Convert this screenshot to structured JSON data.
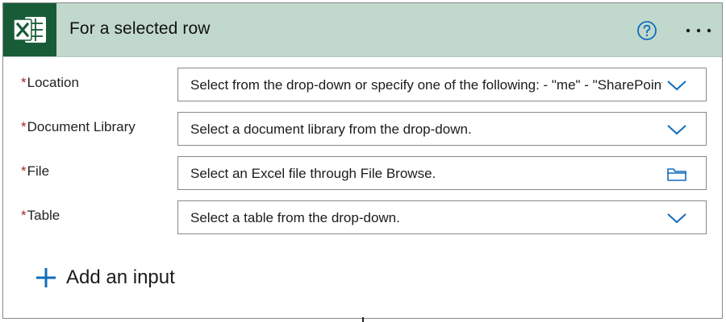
{
  "header": {
    "app_icon": "excel-icon",
    "title": "For a selected row",
    "help_icon": "help-circle-icon",
    "more_icon": "ellipsis-icon"
  },
  "fields": [
    {
      "label": "Location",
      "required_mark": "*",
      "value": "Select from the drop-down or specify one of the following: - \"me\" - \"SharePoint Site URL\"",
      "icon": "chevron-down-icon"
    },
    {
      "label": "Document Library",
      "required_mark": "*",
      "value": "Select a document library from the drop-down.",
      "icon": "chevron-down-icon"
    },
    {
      "label": "File",
      "required_mark": "*",
      "value": "Select an Excel file through File Browse.",
      "icon": "folder-icon"
    },
    {
      "label": "Table",
      "required_mark": "*",
      "value": "Select a table from the drop-down.",
      "icon": "chevron-down-icon"
    }
  ],
  "add_input": {
    "label": "Add an input",
    "icon": "plus-icon"
  },
  "colors": {
    "header_bg": "#c1d9cc",
    "excel_green": "#185c37",
    "accent_blue": "#0f6cbd",
    "required_red": "#a4262c"
  }
}
